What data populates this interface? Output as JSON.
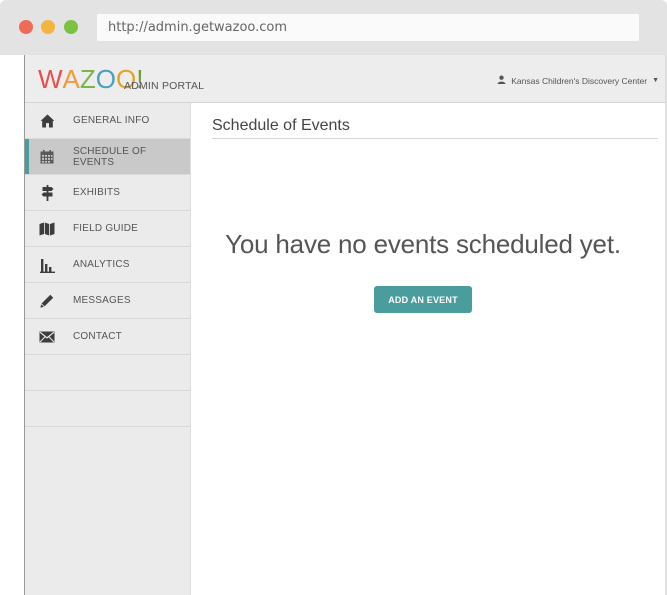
{
  "browser": {
    "url": "http://admin.getwazoo.com"
  },
  "header": {
    "logo": {
      "letters": [
        "W",
        "A",
        "Z",
        "O",
        "O",
        "!"
      ],
      "letter_colors": [
        "#e8504f",
        "#f29a38",
        "#7ab648",
        "#4aa0c2",
        "#e4a22a",
        "#6b9c45"
      ]
    },
    "portal_label": "ADMIN PORTAL",
    "user_name": "Kansas Children's Discovery Center",
    "user_icon": "person-icon",
    "dropdown_icon": "caret-down-icon"
  },
  "sidebar": {
    "items": [
      {
        "label": "GENERAL INFO",
        "icon": "home-icon",
        "active": false
      },
      {
        "label": "SCHEDULE OF EVENTS",
        "icon": "calendar-icon",
        "active": true
      },
      {
        "label": "EXHIBITS",
        "icon": "signpost-icon",
        "active": false
      },
      {
        "label": "FIELD GUIDE",
        "icon": "map-icon",
        "active": false
      },
      {
        "label": "ANALYTICS",
        "icon": "bar-chart-icon",
        "active": false
      },
      {
        "label": "MESSAGES",
        "icon": "pencil-icon",
        "active": false
      },
      {
        "label": "CONTACT",
        "icon": "envelope-icon",
        "active": false
      }
    ]
  },
  "main": {
    "title": "Schedule of Events",
    "empty_message": "You have no events scheduled yet.",
    "add_button_label": "ADD AN EVENT"
  },
  "colors": {
    "accent": "#4a9d9c",
    "sidebar_bg": "#ebebeb",
    "active_bg": "#c9c9c9"
  }
}
